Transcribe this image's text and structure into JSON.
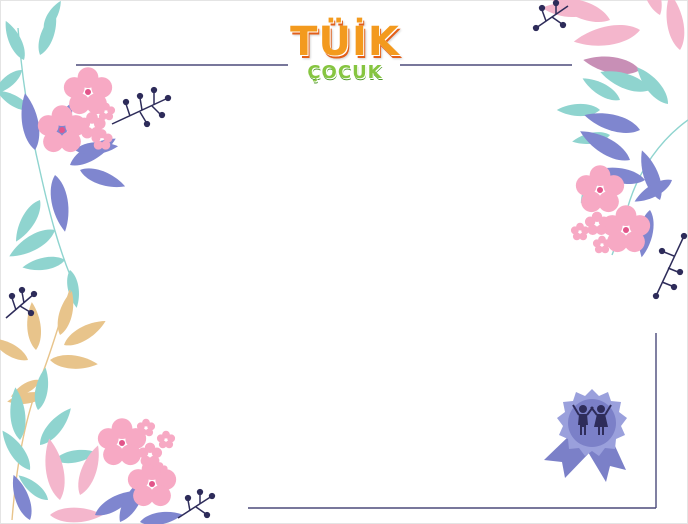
{
  "logo": {
    "title": "TÜİK",
    "subtitle": "ÇOCUK"
  },
  "colors": {
    "frame_line": "#4b4a7a",
    "leaf_teal": "#8fd4cf",
    "leaf_periwinkle": "#7f86cf",
    "leaf_pink": "#f4b6cc",
    "leaf_gold": "#e8c48b",
    "flower_pink": "#f7a9c4",
    "berry_navy": "#2e2c5a",
    "badge_purple": "#7b80c8",
    "logo_orange": "#f39a1e",
    "logo_green": "#86c540"
  },
  "decorations": {
    "badge_icon": "children-holding-hands-icon"
  }
}
